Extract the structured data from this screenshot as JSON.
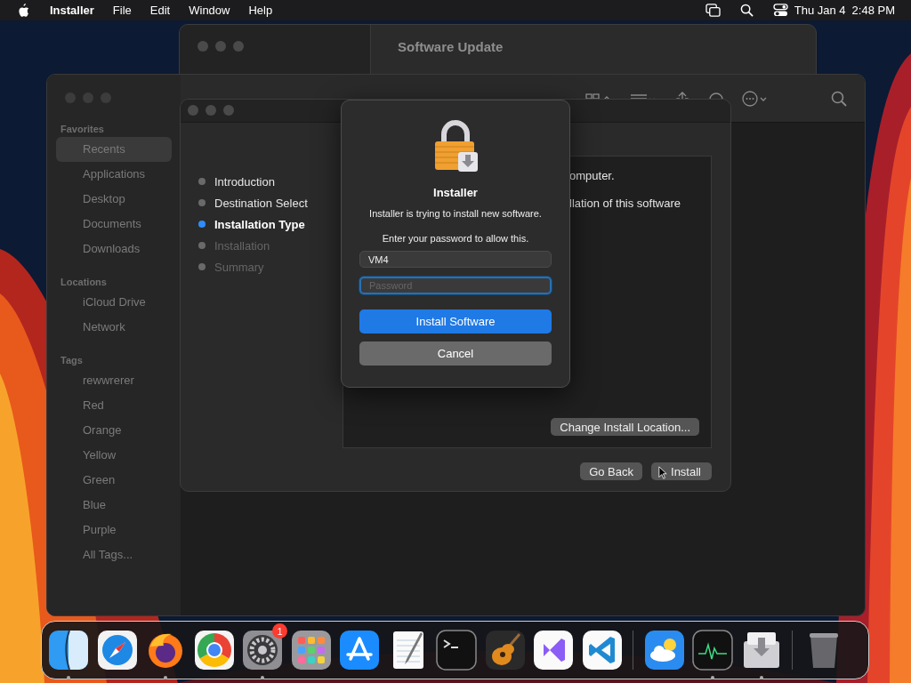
{
  "menu_bar": {
    "app_name": "Installer",
    "menus": [
      "File",
      "Edit",
      "Window",
      "Help"
    ],
    "date": "Thu Jan 4",
    "time": "2:48 PM"
  },
  "software_update_window": {
    "title": "Software Update"
  },
  "finder": {
    "sidebar": [
      {
        "heading": "Favorites",
        "items": [
          {
            "label": "Recents",
            "selected": true
          },
          {
            "label": "Applications",
            "selected": false
          },
          {
            "label": "Desktop",
            "selected": false
          },
          {
            "label": "Documents",
            "selected": false
          },
          {
            "label": "Downloads",
            "selected": false
          }
        ]
      },
      {
        "heading": "Locations",
        "items": [
          {
            "label": "iCloud Drive",
            "selected": false
          },
          {
            "label": "Network",
            "selected": false
          }
        ]
      },
      {
        "heading": "Tags",
        "items": [
          {
            "label": "rewwrerer",
            "selected": false
          },
          {
            "label": "Red",
            "selected": false
          },
          {
            "label": "Orange",
            "selected": false
          },
          {
            "label": "Yellow",
            "selected": false
          },
          {
            "label": "Green",
            "selected": false
          },
          {
            "label": "Blue",
            "selected": false
          },
          {
            "label": "Purple",
            "selected": false
          },
          {
            "label": "All Tags...",
            "selected": false
          }
        ]
      }
    ]
  },
  "installer": {
    "steps": [
      {
        "label": "Introduction",
        "selected": false,
        "disabled": false
      },
      {
        "label": "Destination Select",
        "selected": false,
        "disabled": false
      },
      {
        "label": "Installation Type",
        "selected": true,
        "disabled": false
      },
      {
        "label": "Installation",
        "selected": false,
        "disabled": true
      },
      {
        "label": "Summary",
        "selected": false,
        "disabled": true
      }
    ],
    "body_lines": [
      "omputer.",
      "llation of this software"
    ],
    "change_location_button": "Change Install Location...",
    "back_button": "Go Back",
    "continue_button": "Install"
  },
  "auth_dialog": {
    "title": "Installer",
    "message": "Installer is trying to install new software.",
    "prompt": "Enter your password to allow this.",
    "username": "VM4",
    "password_placeholder": "Password",
    "password_focused": true,
    "confirm_button": "Install Software",
    "cancel_button": "Cancel"
  },
  "dock": {
    "groups": [
      {
        "items": [
          {
            "running": true
          },
          {
            "running": false
          },
          {
            "running": true
          },
          {
            "running": false
          },
          {
            "running": true,
            "badge": "1"
          },
          {
            "running": false
          },
          {
            "running": false
          },
          {
            "running": false
          },
          {
            "running": false
          },
          {
            "running": false
          },
          {
            "running": false
          },
          {
            "running": false
          }
        ]
      },
      {
        "items": [
          {
            "running": false
          },
          {
            "running": true
          },
          {
            "running": true
          }
        ]
      },
      {
        "items": [
          {
            "running": false
          }
        ]
      }
    ]
  }
}
